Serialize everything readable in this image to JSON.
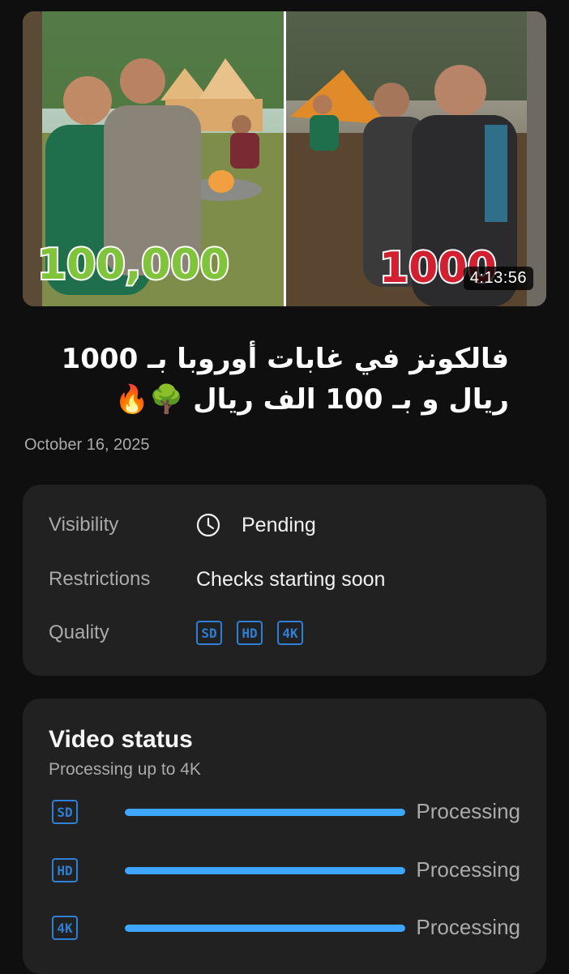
{
  "video": {
    "thumbnail": {
      "left_price": "100,000",
      "right_price": "1000",
      "currency_symbol": "⃁",
      "duration": "4:13:56"
    },
    "title": "فالكونز في غابات أوروبا بـ 1000 ريال و بـ 100 الف ريال 🌳🔥",
    "date": "October 16, 2025"
  },
  "details": {
    "visibility": {
      "label": "Visibility",
      "value": "Pending",
      "icon": "clock-icon"
    },
    "restrictions": {
      "label": "Restrictions",
      "value": "Checks starting soon"
    },
    "quality": {
      "label": "Quality",
      "badges": [
        "SD",
        "HD",
        "4K"
      ]
    }
  },
  "status": {
    "title": "Video status",
    "subtitle": "Processing up to 4K",
    "rows": [
      {
        "badge": "SD",
        "text": "Processing",
        "progress": 1.0
      },
      {
        "badge": "HD",
        "text": "Processing",
        "progress": 1.0
      },
      {
        "badge": "4K",
        "text": "Processing",
        "progress": 1.0
      }
    ]
  },
  "colors": {
    "accent": "#3ea6ff",
    "badge_blue": "#2f7fd4",
    "card_bg": "#212121",
    "page_bg": "#0f0f0f"
  }
}
